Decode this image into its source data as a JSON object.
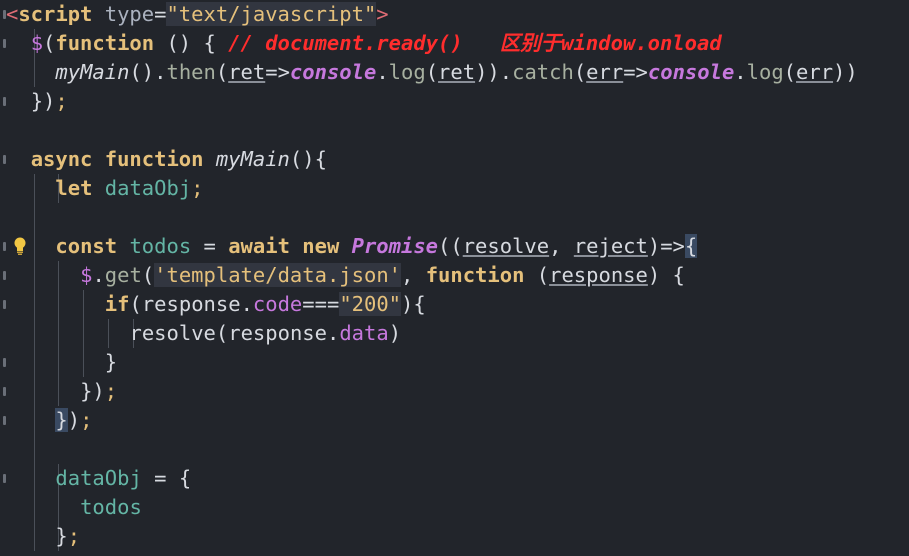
{
  "editor": {
    "lines": [
      {
        "tokens": [
          [
            "tag",
            "<"
          ],
          [
            "kw",
            "script"
          ],
          [
            "attr",
            " type"
          ],
          [
            "punct",
            "="
          ],
          [
            "str",
            "\"text/javascript\""
          ],
          [
            "tag",
            ">"
          ]
        ]
      },
      {
        "tokens": [
          [
            "dollar",
            "$"
          ],
          [
            "punct",
            "("
          ],
          [
            "kw",
            "function"
          ],
          [
            "punct",
            " () { "
          ],
          [
            "cmt",
            "// document.ready()   区别于window.onload"
          ]
        ]
      },
      {
        "tokens": [
          [
            "fnname",
            "myMain"
          ],
          [
            "punct",
            "()."
          ],
          [
            "method",
            "then"
          ],
          [
            "punct",
            "("
          ],
          [
            "ul",
            "ret"
          ],
          [
            "punct",
            "=>"
          ],
          [
            "obj",
            "console"
          ],
          [
            "punct",
            "."
          ],
          [
            "method",
            "log"
          ],
          [
            "punct",
            "("
          ],
          [
            "ul",
            "ret"
          ],
          [
            "punct",
            "))."
          ],
          [
            "method",
            "catch"
          ],
          [
            "punct",
            "("
          ],
          [
            "ul",
            "err"
          ],
          [
            "punct",
            "=>"
          ],
          [
            "obj",
            "console"
          ],
          [
            "punct",
            "."
          ],
          [
            "method",
            "log"
          ],
          [
            "punct",
            "("
          ],
          [
            "ul",
            "err"
          ],
          [
            "punct",
            "))"
          ]
        ]
      },
      {
        "tokens": [
          [
            "punct",
            "})"
          ],
          [
            "semi",
            ";"
          ]
        ]
      },
      {
        "tokens": []
      },
      {
        "tokens": [
          [
            "kw",
            "async function "
          ],
          [
            "fnname",
            "myMain"
          ],
          [
            "punct",
            "(){"
          ]
        ]
      },
      {
        "tokens": [
          [
            "kw",
            "let "
          ],
          [
            "var",
            "dataObj"
          ],
          [
            "semi",
            ";"
          ]
        ]
      },
      {
        "tokens": []
      },
      {
        "tokens": [
          [
            "kw",
            "const "
          ],
          [
            "var",
            "todos"
          ],
          [
            "punct",
            " = "
          ],
          [
            "kw",
            "await new "
          ],
          [
            "obj",
            "Promise"
          ],
          [
            "punct",
            "(("
          ],
          [
            "ul",
            "resolve"
          ],
          [
            "punct",
            ", "
          ],
          [
            "ul",
            "reject"
          ],
          [
            "punct",
            ")=>"
          ],
          [
            "bracket",
            "{"
          ]
        ]
      },
      {
        "tokens": [
          [
            "dollar",
            "$"
          ],
          [
            "punct",
            "."
          ],
          [
            "method",
            "get"
          ],
          [
            "punct",
            "("
          ],
          [
            "str",
            "'template/data.json'"
          ],
          [
            "punct",
            ", "
          ],
          [
            "kw",
            "function "
          ],
          [
            "punct",
            "("
          ],
          [
            "ul",
            "response"
          ],
          [
            "punct",
            ") {"
          ]
        ]
      },
      {
        "tokens": [
          [
            "kw",
            "if"
          ],
          [
            "punct",
            "(response."
          ],
          [
            "prop",
            "code"
          ],
          [
            "punct",
            "==="
          ],
          [
            "str",
            "\"200\""
          ],
          [
            "punct",
            "){"
          ]
        ]
      },
      {
        "tokens": [
          [
            "punct",
            "resolve(response."
          ],
          [
            "prop",
            "data"
          ],
          [
            "punct",
            ")"
          ]
        ]
      },
      {
        "tokens": [
          [
            "punct",
            "}"
          ]
        ]
      },
      {
        "tokens": [
          [
            "punct",
            "})"
          ],
          [
            "semi",
            ";"
          ]
        ]
      },
      {
        "tokens": [
          [
            "bracket",
            "}"
          ],
          [
            "punct",
            ")"
          ],
          [
            "semi",
            ";"
          ]
        ]
      },
      {
        "tokens": []
      },
      {
        "tokens": [
          [
            "var",
            "dataObj"
          ],
          [
            "punct",
            " = {"
          ]
        ]
      },
      {
        "tokens": [
          [
            "var",
            "todos"
          ]
        ]
      },
      {
        "tokens": [
          [
            "punct",
            "}"
          ],
          [
            "semi",
            ";"
          ]
        ]
      }
    ]
  }
}
